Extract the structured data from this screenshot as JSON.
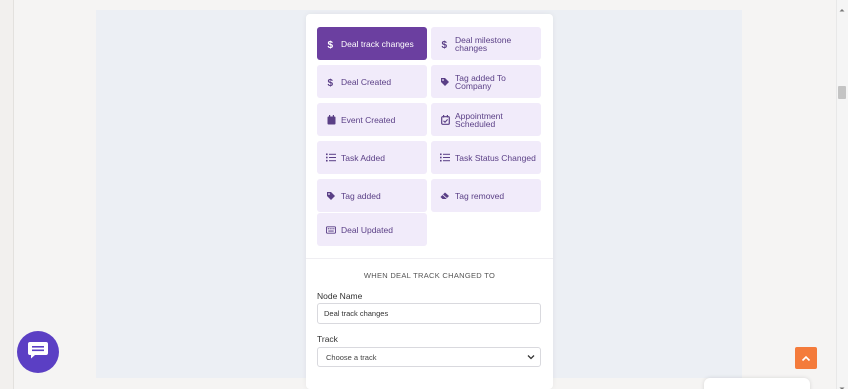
{
  "colors": {
    "accent": "#6b3fa0",
    "tile_bg": "#f1ebfa",
    "tile_text": "#5a3f86",
    "chat_button": "#5b3fc4",
    "scroll_top_button": "#f47b3b"
  },
  "triggers": [
    {
      "label": "Deal track changes",
      "icon": "dollar-icon",
      "active": true
    },
    {
      "label": "Deal milestone changes",
      "icon": "dollar-icon",
      "active": false
    },
    {
      "label": "Deal Created",
      "icon": "dollar-icon",
      "active": false
    },
    {
      "label": "Tag added To Company",
      "icon": "tag-icon",
      "active": false
    },
    {
      "label": "Event Created",
      "icon": "calendar-icon",
      "active": false
    },
    {
      "label": "Appointment Scheduled",
      "icon": "calendar-check-icon",
      "active": false
    },
    {
      "label": "Task Added",
      "icon": "list-icon",
      "active": false
    },
    {
      "label": "Task Status Changed",
      "icon": "list-icon",
      "active": false
    },
    {
      "label": "Tag added",
      "icon": "tag-icon",
      "active": false
    },
    {
      "label": "Tag removed",
      "icon": "eraser-icon",
      "active": false
    },
    {
      "label": "Deal Updated",
      "icon": "keyboard-icon",
      "active": false
    }
  ],
  "form": {
    "section_title": "WHEN DEAL TRACK CHANGED TO",
    "node_name_label": "Node Name",
    "node_name_value": "Deal track changes",
    "track_label": "Track",
    "track_selected": "Choose a track"
  }
}
